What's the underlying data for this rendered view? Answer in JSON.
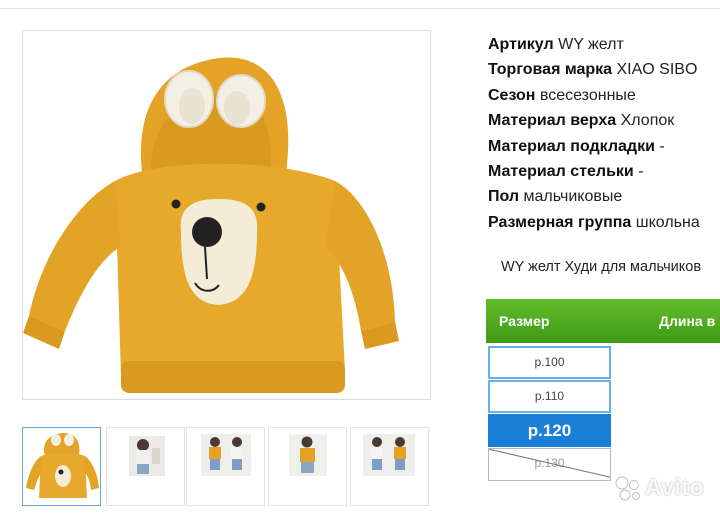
{
  "specs": [
    {
      "label": "Артикул",
      "value": "WY желт"
    },
    {
      "label": "Торговая марка",
      "value": "XIAO SIBO"
    },
    {
      "label": "Сезон",
      "value": "всесезонные"
    },
    {
      "label": "Материал верха",
      "value": "Хлопок"
    },
    {
      "label": "Материал подкладки",
      "value": "-"
    },
    {
      "label": "Материал стельки",
      "value": "-"
    },
    {
      "label": "Пол",
      "value": "мальчиковые"
    },
    {
      "label": "Размерная группа",
      "value": "школьна"
    }
  ],
  "description": "WY желт Худи для мальчиков",
  "size_table": {
    "col_size": "Размер",
    "col_length": "Длина в"
  },
  "sizes": [
    {
      "label": "р.100",
      "state": "available"
    },
    {
      "label": "р.110",
      "state": "available"
    },
    {
      "label": "р.120",
      "state": "selected"
    },
    {
      "label": "р.130",
      "state": "unavailable"
    }
  ],
  "watermark": "Avito",
  "colors": {
    "hoodie": "#e7a92b",
    "header_green": "#4fa91f",
    "selected_blue": "#1b7fd8",
    "outline_blue": "#64b2e8"
  },
  "icons": [
    "avito-logo-icon"
  ]
}
